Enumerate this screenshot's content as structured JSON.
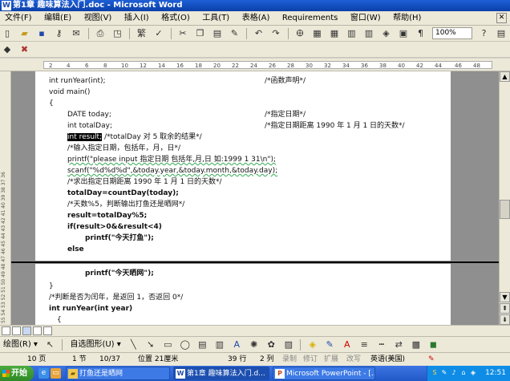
{
  "window": {
    "title": "第1章 趣味算法入门.doc - Microsoft Word"
  },
  "menu": [
    "文件(F)",
    "编辑(E)",
    "视图(V)",
    "插入(I)",
    "格式(O)",
    "工具(T)",
    "表格(A)",
    "Requirements",
    "窗口(W)",
    "帮助(H)"
  ],
  "toolbar": {
    "zoom": "100%"
  },
  "ruler": {
    "ticks": [
      "2",
      "4",
      "6",
      "8",
      "10",
      "12",
      "14",
      "16",
      "18",
      "20",
      "22",
      "24",
      "26",
      "28",
      "30",
      "32",
      "34",
      "36",
      "38",
      "40",
      "42",
      "44",
      "46",
      "48"
    ]
  },
  "vruler": {
    "text": "55 54 53 52 51 50 49 48 47 46 45 44 43 42 41 40 39 38 37 36"
  },
  "code": {
    "l1": "int runYear(int);",
    "l1c": "/*函数声明*/",
    "l2": "void main()",
    "l3": "{",
    "l4": "DATE   today;",
    "l4c": "/*指定日期*/",
    "l5": "int totalDay;",
    "l5c": "/*指定日期距离 1990 年 1 月 1 日的天数*/",
    "l6a": "int result;",
    "l6b": "/*totalDay 对 5 取余的结果*/",
    "l7": "/*输入指定日期，包括年，月，日*/",
    "l8": "printf(\"please input  指定日期  包括年,月,日  如:1999 1 31\\n\");",
    "l9": "scanf(\"%d%d%d\",&today.year,&today.month,&today.day);",
    "l10": "/*求出指定日期距离 1990 年 1 月 1 日的天数*/",
    "l11": "totalDay=countDay(today);",
    "l12": "/*天数%5，判断输出打鱼还是晒网*/",
    "l13": "result=totalDay%5;",
    "l14": "if(result>0&&result<4)",
    "l15": "printf(\"今天打鱼\");",
    "l16": "else",
    "l17": "printf(\"今天晒网\");",
    "l18": "}",
    "l19": "/*判断是否为闰年，是返回 1，否返回 0*/",
    "l20": "int runYear(int year)",
    "l21": "{"
  },
  "drawbar": {
    "draw_label": "绘图(R) ▾",
    "autoshape_label": "自选图形(U) ▾"
  },
  "status": {
    "page": "10 页",
    "section": "1 节",
    "pages": "10/37",
    "position": "位置 21厘米",
    "line": "39 行",
    "column": "2 列",
    "rec": "录制",
    "trk": "修订",
    "ext": "扩展",
    "ovr": "改写",
    "lang": "英语(美国)"
  },
  "taskbar": {
    "start": "开始",
    "tasks": [
      "打鱼还是晒网",
      "第1章 趣味算法入门.d...",
      "Microsoft PowerPoint - [..."
    ],
    "clock": "12:51"
  }
}
